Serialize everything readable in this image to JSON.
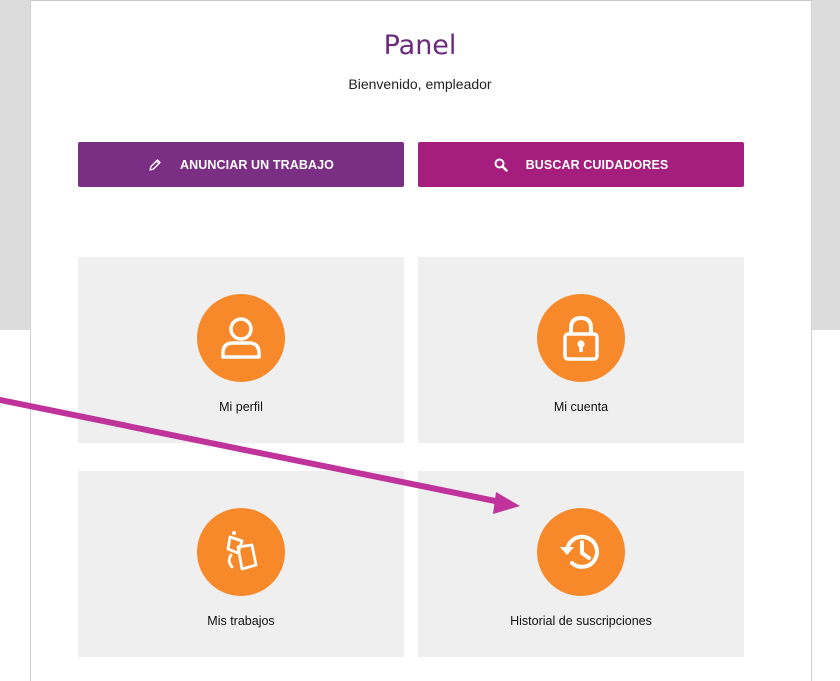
{
  "header": {
    "title": "Panel",
    "subtitle": "Bienvenido, empleador"
  },
  "actions": [
    {
      "label": "ANUNCIAR UN TRABAJO",
      "icon": "pencil-icon",
      "color": "#7b2f84"
    },
    {
      "label": "BUSCAR CUIDADORES",
      "icon": "search-icon",
      "color": "#a51e7d"
    }
  ],
  "tiles": [
    {
      "label": "Mi perfil",
      "icon": "user-icon"
    },
    {
      "label": "Mi cuenta",
      "icon": "lock-icon"
    },
    {
      "label": "Mis trabajos",
      "icon": "jobs-icon"
    },
    {
      "label": "Historial de suscripciones",
      "icon": "history-icon"
    }
  ],
  "colors": {
    "title": "#6c2a7f",
    "tile_icon_bg": "#f7892a",
    "tile_bg": "#efefef",
    "annotation_arrow": "#c0339a"
  }
}
